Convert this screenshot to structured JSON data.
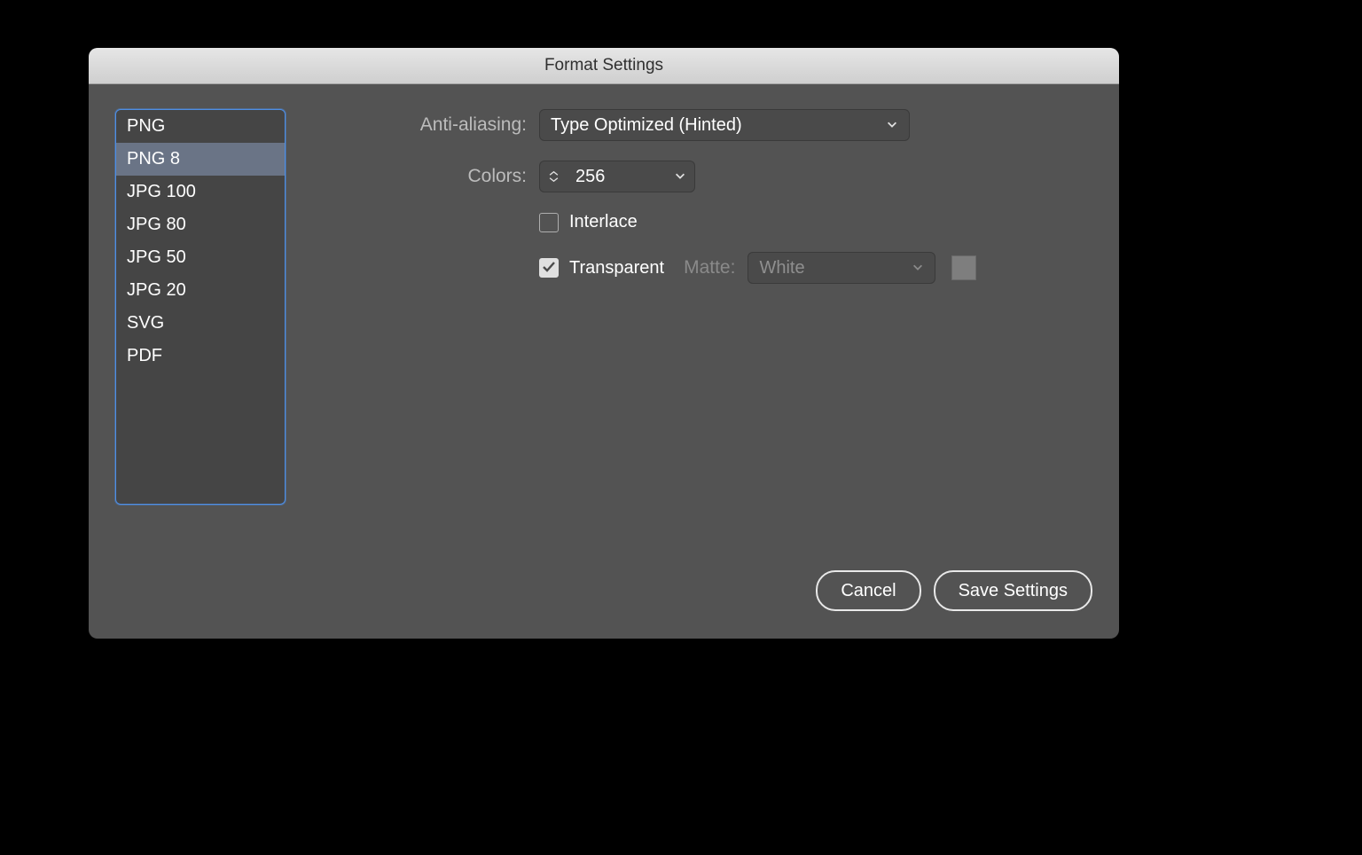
{
  "dialog": {
    "title": "Format Settings",
    "formats": [
      "PNG",
      "PNG 8",
      "JPG 100",
      "JPG 80",
      "JPG 50",
      "JPG 20",
      "SVG",
      "PDF"
    ],
    "selected_index": 1
  },
  "form": {
    "antialias_label": "Anti-aliasing:",
    "antialias_value": "Type Optimized (Hinted)",
    "colors_label": "Colors:",
    "colors_value": "256",
    "interlace_label": "Interlace",
    "interlace_checked": false,
    "transparent_label": "Transparent",
    "transparent_checked": true,
    "matte_label": "Matte:",
    "matte_value": "White"
  },
  "buttons": {
    "cancel": "Cancel",
    "save": "Save Settings"
  }
}
